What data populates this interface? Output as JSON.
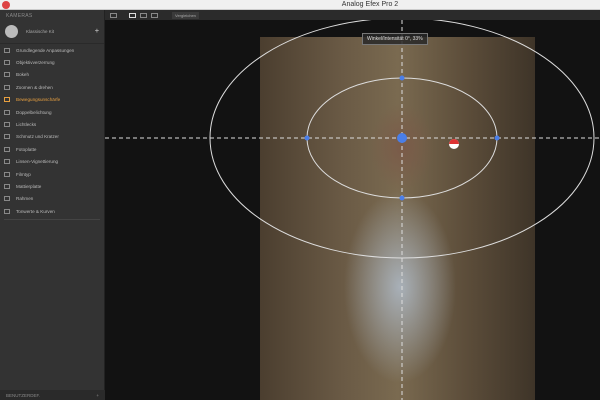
{
  "window": {
    "title": "Analog Efex Pro 2"
  },
  "sidebar": {
    "header": "KAMERAS",
    "preset": "Klassische Kit",
    "items": [
      {
        "label": "Grundlegende Anpassungen"
      },
      {
        "label": "Objektivverzerrung"
      },
      {
        "label": "Bokeh"
      },
      {
        "label": "Zoomen & drehen"
      },
      {
        "label": "Bewegungsunschärfe",
        "active": true
      },
      {
        "label": "Doppelbelichtung"
      },
      {
        "label": "Lichtlecks"
      },
      {
        "label": "Schmutz und Kratzer"
      },
      {
        "label": "Fotoplatte"
      },
      {
        "label": "Linsen-Vignettierung"
      },
      {
        "label": "Filmtyp"
      },
      {
        "label": "Mattierplatte"
      },
      {
        "label": "Rahmen"
      },
      {
        "label": "Tonwerte & Kurven"
      }
    ],
    "footer": "BENUTZERDEF.",
    "footer_plus": "+"
  },
  "toolbar": {
    "compare": "Vergleichen"
  },
  "canvas": {
    "tooltip": "Winkel/Intensität  0°, 33%"
  },
  "colors": {
    "accent": "#e8a040",
    "control_point": "#4a7ee8"
  }
}
